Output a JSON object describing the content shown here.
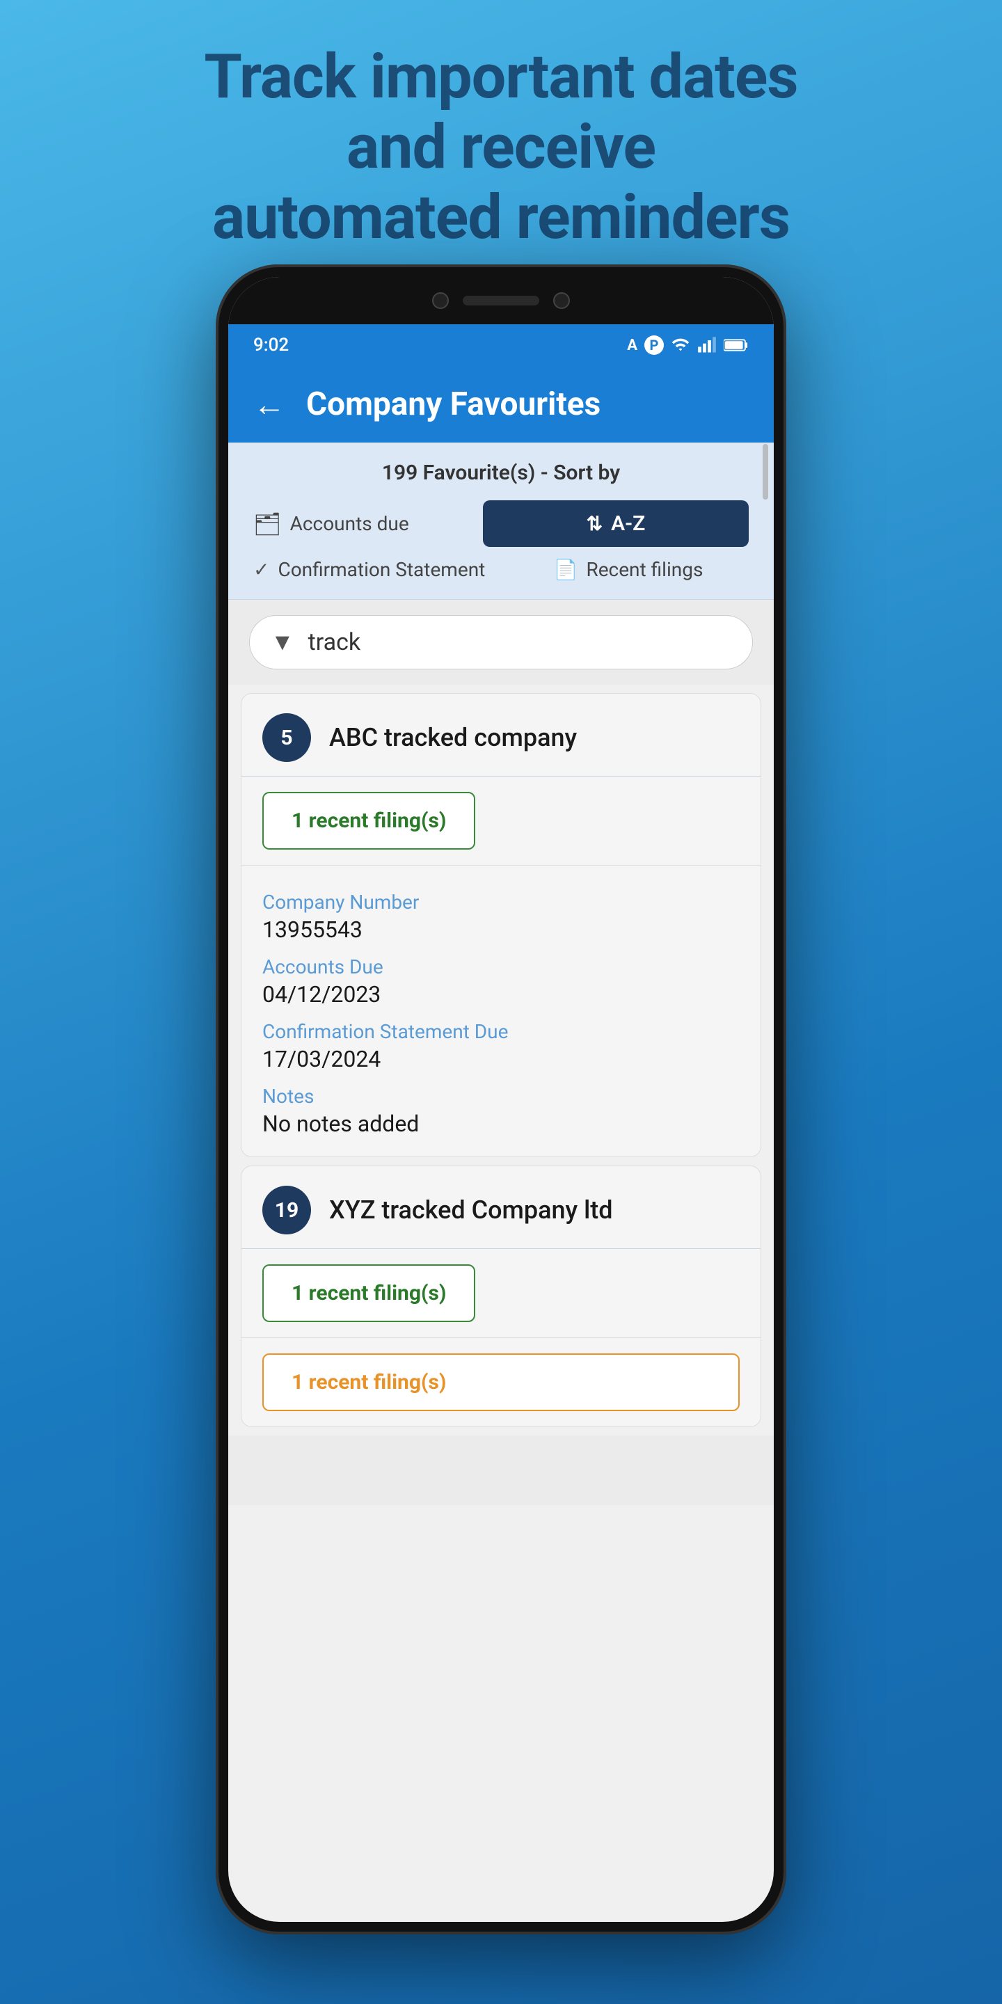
{
  "hero": {
    "line1": "Track important dates",
    "line2": "and receive",
    "line3": "automated reminders"
  },
  "statusBar": {
    "time": "9:02",
    "wifi": true,
    "signal": true,
    "battery": true
  },
  "appBar": {
    "title": "Company Favourites",
    "backLabel": "←"
  },
  "sortBar": {
    "heading": "199 Favourite(s) - Sort by",
    "option1Label": "Accounts due",
    "option2Label": "A-Z",
    "option3Label": "Confirmation Statement",
    "option4Label": "Recent filings"
  },
  "search": {
    "placeholder": "track",
    "value": "track"
  },
  "company1": {
    "badge": "5",
    "name": "ABC tracked company",
    "filingLabel": "1 recent filing(s)",
    "companyNumberLabel": "Company Number",
    "companyNumber": "13955543",
    "accountsDueLabel": "Accounts Due",
    "accountsDue": "04/12/2023",
    "confirmationLabel": "Confirmation Statement Due",
    "confirmationDate": "17/03/2024",
    "notesLabel": "Notes",
    "notesValue": "No notes added"
  },
  "company2": {
    "badge": "19",
    "name": "XYZ  tracked Company ltd",
    "filingLabel": "1 recent filing(s)",
    "statusLabel": "1 recent filing(s)"
  }
}
